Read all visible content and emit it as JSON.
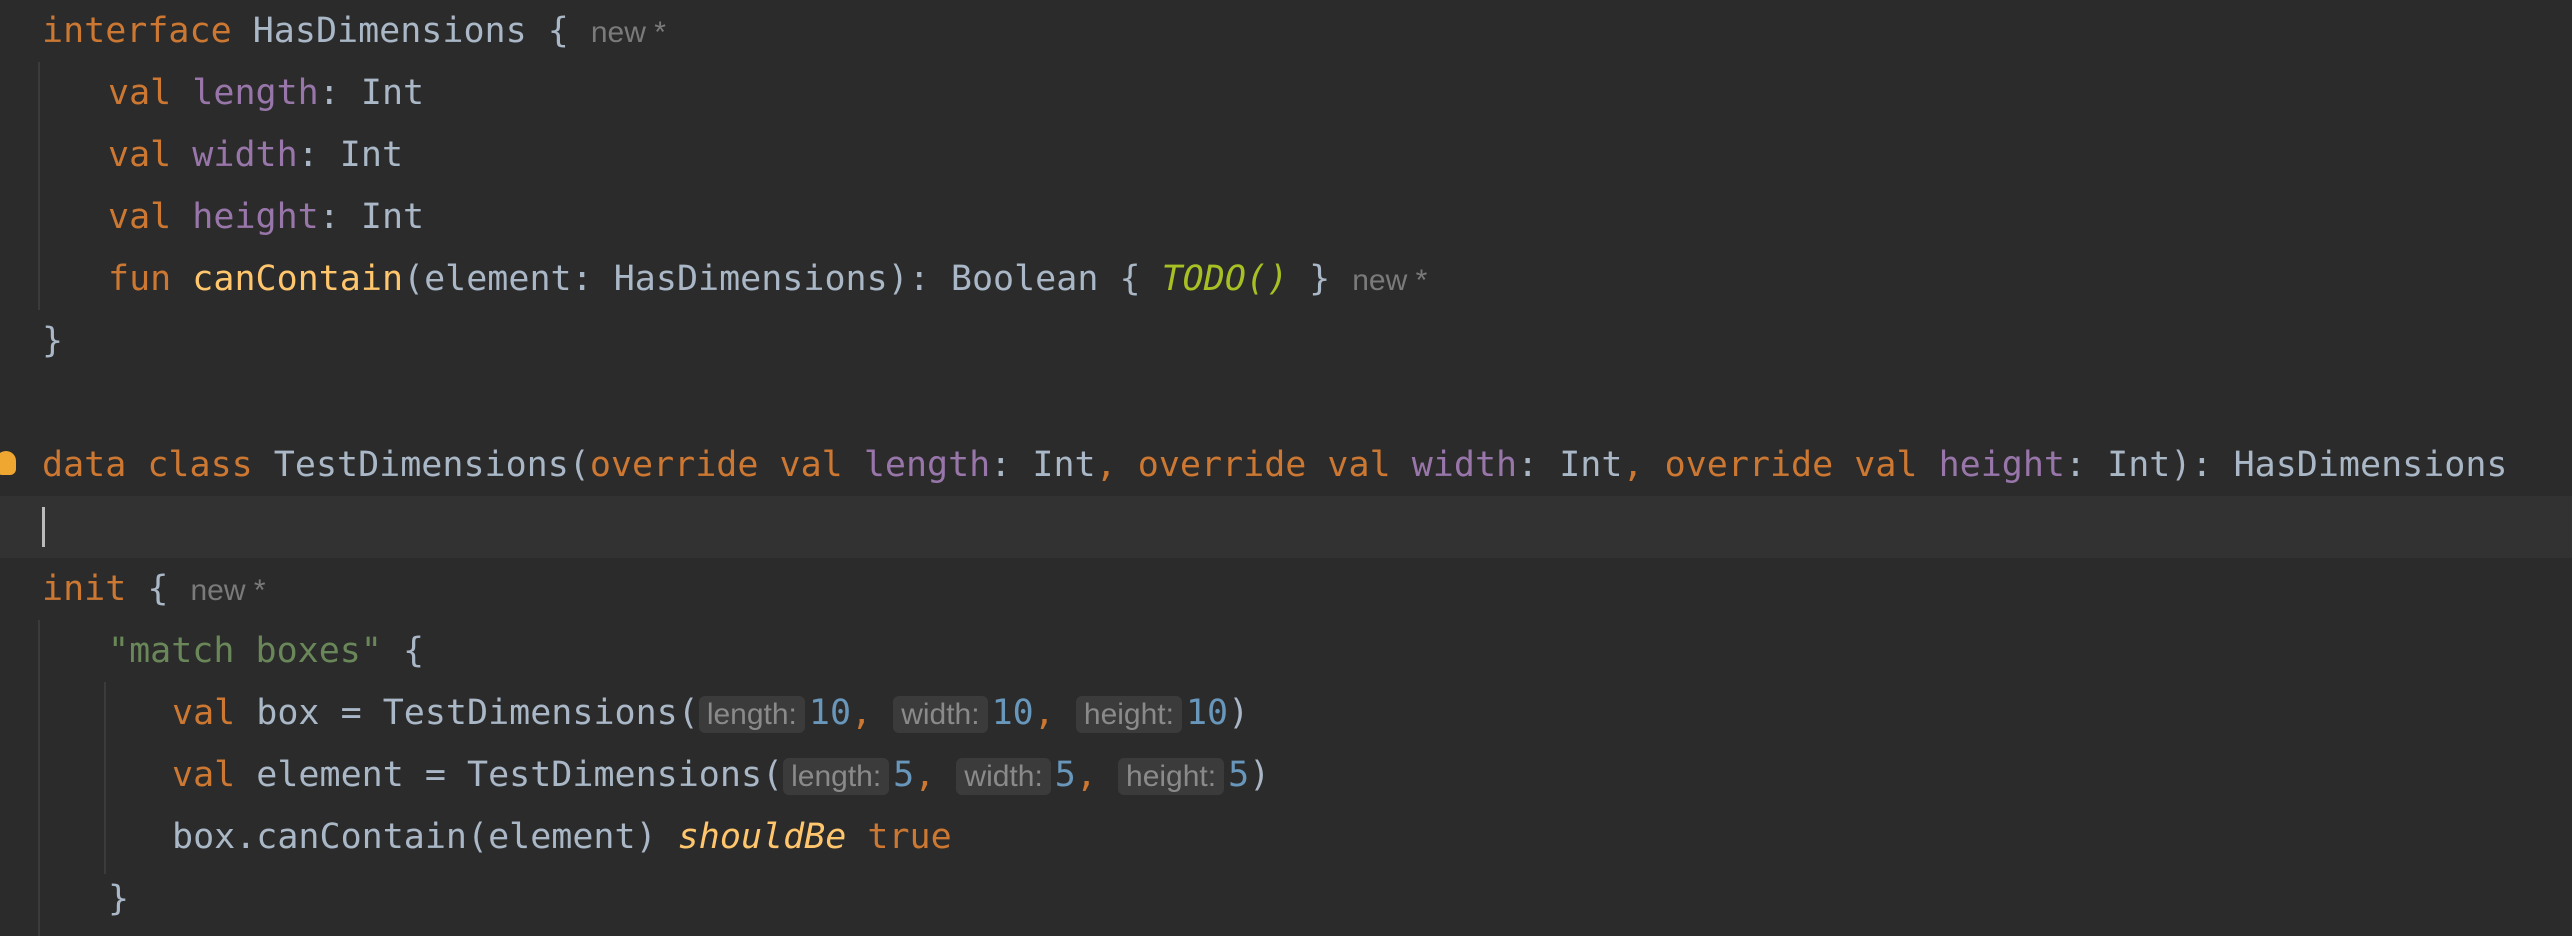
{
  "editor": {
    "new_hint": "new *",
    "lines": {
      "l1": {
        "kw": "interface",
        "name": "HasDimensions",
        "brace": " {"
      },
      "l2": {
        "kw": "val",
        "prop": "length",
        "rest": ": Int"
      },
      "l3": {
        "kw": "val",
        "prop": "width",
        "rest": ": Int"
      },
      "l4": {
        "kw": "val",
        "prop": "height",
        "rest": ": Int"
      },
      "l5": {
        "kw": "fun",
        "fn": "canContain",
        "sig": "(element: HasDimensions): Boolean { ",
        "todo": "TODO()",
        "close": " }"
      },
      "l6": {
        "text": "}"
      },
      "l8": {
        "kw1": "data class",
        "name": "TestDimensions(",
        "kw2": "override val",
        "p1": "length",
        "t1": ": Int",
        "comma1": ", ",
        "kw3": "override val",
        "p2": "width",
        "t2": ": Int",
        "comma2": ", ",
        "kw4": "override val",
        "p3": "height",
        "t3": ": Int",
        "tail": "): HasDimensions"
      },
      "l10": {
        "kw": "init",
        "brace": " {"
      },
      "l11": {
        "str": "\"match boxes\"",
        "brace": " {"
      },
      "l12": {
        "kw": "val",
        "decl": " box = TestDimensions(",
        "h1": "length:",
        "v1": "10",
        "h2": "width:",
        "v2": "10",
        "h3": "height:",
        "v3": "10",
        "close": ")"
      },
      "l13": {
        "kw": "val",
        "decl": " element = TestDimensions(",
        "h1": "length:",
        "v1": "5",
        "h2": "width:",
        "v2": "5",
        "h3": "height:",
        "v3": "5",
        "close": ")"
      },
      "l14": {
        "expr": "box.canContain(element) ",
        "infix": "shouldBe",
        "kw": " true"
      },
      "l15": {
        "text": "}"
      }
    },
    "comma": ", "
  }
}
